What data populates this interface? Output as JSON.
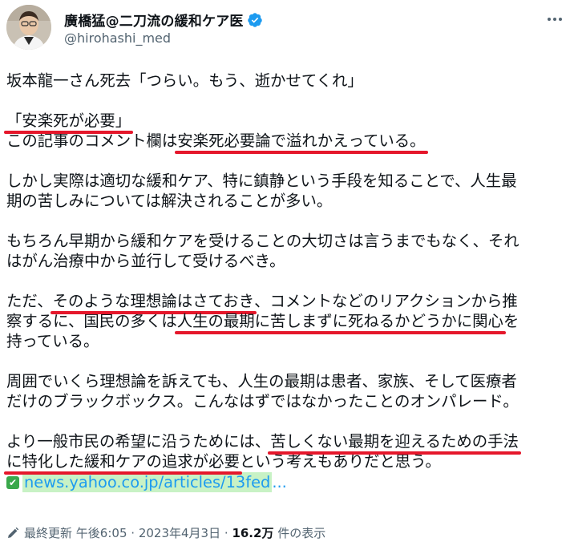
{
  "author": {
    "display_name": "廣橋猛@二刀流の緩和ケア医",
    "handle": "@hirohashi_med",
    "verified": true,
    "avatar_icon": "avatar-photo"
  },
  "tweet": {
    "lines": [
      [
        {
          "t": "坂本龍一さん死去「つらい。もう、逝かせてくれ」"
        }
      ],
      [],
      [
        {
          "t": "「安楽死が必要」",
          "u": true
        }
      ],
      [
        {
          "t": "この記事のコメント欄は"
        },
        {
          "t": "安楽死必要論で溢れかえっている。",
          "u": true
        }
      ],
      [],
      [
        {
          "t": "しかし実際は適切な緩和ケア、特に鎮静という手段を知ることで、人生最"
        }
      ],
      [
        {
          "t": "期の苦しみについては解決されることが多い。"
        }
      ],
      [],
      [
        {
          "t": "もちろん早期から緩和ケアを受けることの大切さは言うまでもなく、それ"
        }
      ],
      [
        {
          "t": "はがん治療中から並行して受けるべき。"
        }
      ],
      [],
      [
        {
          "t": "ただ、"
        },
        {
          "t": "そのような理想論はさておき",
          "u": true
        },
        {
          "t": "、コメントなどのリアクションから推"
        }
      ],
      [
        {
          "t": "察するに、国民の多くは"
        },
        {
          "t": "人生の最期に苦しまずに死ねるかどうかに関心",
          "u": true
        },
        {
          "t": "を"
        }
      ],
      [
        {
          "t": "持っている。"
        }
      ],
      [],
      [
        {
          "t": "周囲でいくら理想論を訴えても、人生の最期は患者、家族、そして医療者"
        }
      ],
      [
        {
          "t": "だけのブラックボックス。こんなはずではなかったことのオンパレード。"
        }
      ],
      [],
      [
        {
          "t": "より一般市民の希望に沿うためには、"
        },
        {
          "t": "苦しくない最期を迎えるための手法",
          "u": true
        }
      ],
      [
        {
          "t": "に特化した緩和ケアの追求が必要",
          "u": true
        },
        {
          "t": "という考えもありだと思う。"
        }
      ]
    ],
    "link_text": "news.yahoo.co.jp/articles/13fed",
    "link_ellipsis": "..."
  },
  "meta": {
    "edited_label": "最終更新",
    "time": "午後6:05",
    "sep1": "·",
    "date": "2023年4月3日",
    "sep2": "·",
    "views_count": "16.2万",
    "views_label": "件の表示"
  },
  "colors": {
    "underline": "#e5172b",
    "link": "#1d9bf0",
    "verified": "#1d9bf0",
    "link_highlight": "#c8f2c5"
  }
}
